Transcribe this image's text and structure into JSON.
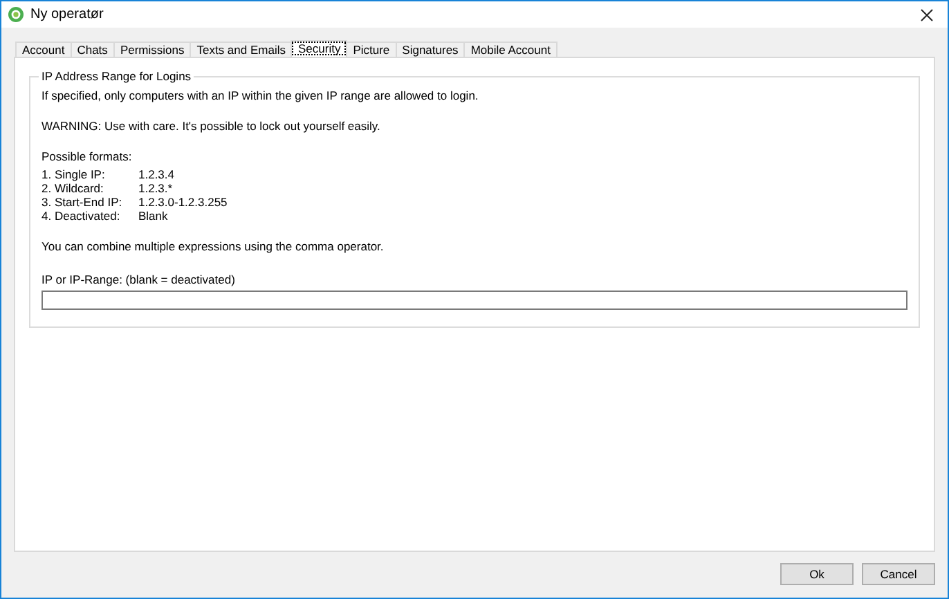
{
  "window": {
    "title": "Ny operatør"
  },
  "tabs": [
    {
      "label": "Account",
      "selected": false
    },
    {
      "label": "Chats",
      "selected": false
    },
    {
      "label": "Permissions",
      "selected": false
    },
    {
      "label": "Texts and Emails",
      "selected": false
    },
    {
      "label": "Security",
      "selected": true
    },
    {
      "label": "Picture",
      "selected": false
    },
    {
      "label": "Signatures",
      "selected": false
    },
    {
      "label": "Mobile Account",
      "selected": false
    }
  ],
  "group": {
    "title": "IP Address Range for Logins",
    "intro": "If specified, only computers with an IP within the given IP range are allowed to login.",
    "warning": "WARNING: Use with care. It's possible to lock out yourself easily.",
    "formats_heading": "Possible formats:",
    "formats": [
      {
        "label": "1. Single IP:",
        "value": "1.2.3.4"
      },
      {
        "label": "2. Wildcard:",
        "value": "1.2.3.*"
      },
      {
        "label": "3. Start-End IP:",
        "value": "1.2.3.0-1.2.3.255"
      },
      {
        "label": "4. Deactivated:",
        "value": "Blank"
      }
    ],
    "combine": "You can combine multiple expressions using the comma operator.",
    "field_label": "IP or IP-Range: (blank = deactivated)"
  },
  "buttons": [
    "Ok",
    "Cancel"
  ]
}
